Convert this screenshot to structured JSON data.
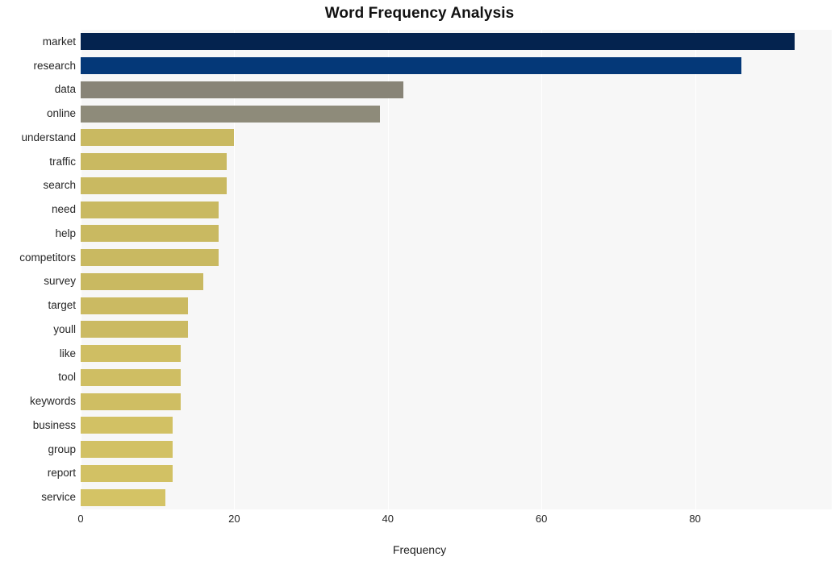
{
  "chart_data": {
    "type": "bar",
    "orientation": "horizontal",
    "title": "Word Frequency Analysis",
    "xlabel": "Frequency",
    "ylabel": "",
    "xlim": [
      0,
      97.8
    ],
    "xticks": [
      0,
      20,
      40,
      60,
      80
    ],
    "xtick_labels": [
      "0",
      "20",
      "40",
      "60",
      "80"
    ],
    "grid": true,
    "grid_axis": "x",
    "legend": false,
    "plot_background": "#f7f7f7",
    "figure_background": "#ffffff",
    "categories": [
      "market",
      "research",
      "data",
      "online",
      "understand",
      "traffic",
      "search",
      "need",
      "help",
      "competitors",
      "survey",
      "target",
      "youll",
      "like",
      "tool",
      "keywords",
      "business",
      "group",
      "report",
      "service"
    ],
    "values": [
      93,
      86,
      42,
      39,
      20,
      19,
      19,
      18,
      18,
      18,
      16,
      14,
      14,
      13,
      13,
      13,
      12,
      12,
      12,
      11
    ],
    "bar_colors": [
      "#04234f",
      "#043878",
      "#888477",
      "#8e8b7a",
      "#c9b961",
      "#c9b961",
      "#c9b961",
      "#c9b961",
      "#c9b961",
      "#c9b961",
      "#c9b961",
      "#cbba62",
      "#cbba62",
      "#cfbe63",
      "#cfbe63",
      "#cfbe63",
      "#d2c164",
      "#d2c164",
      "#d2c164",
      "#d4c365"
    ]
  }
}
